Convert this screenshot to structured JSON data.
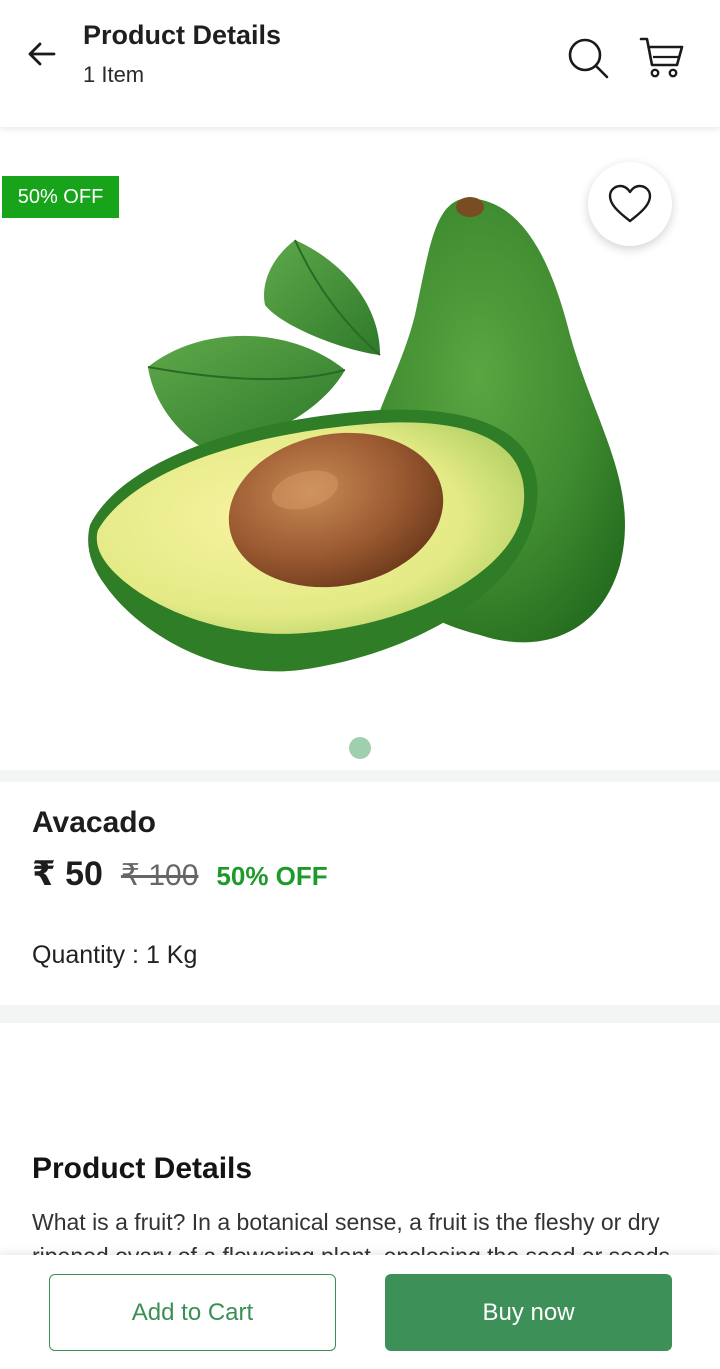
{
  "header": {
    "title": "Product Details",
    "subtitle": "1 Item",
    "icons": [
      "back-arrow-icon",
      "search-icon",
      "cart-icon"
    ]
  },
  "gallery": {
    "discount_tag": "50% OFF",
    "wishlist_icon": "heart-icon",
    "image": "avocado",
    "page_count": 1,
    "active_page": 1
  },
  "product": {
    "name": "Avacado",
    "price": "₹ 50",
    "mrp": "₹ 100",
    "discount": "50% OFF",
    "quantity": "Quantity : 1 Kg"
  },
  "details": {
    "title": "Product Details",
    "text": "What is a fruit? In a botanical sense, a fruit is the fleshy or dry ripened ovary of a flowering plant, enclosing the seed or seeds."
  },
  "actions": {
    "add_to_cart": "Add to Cart",
    "buy_now": "Buy now"
  },
  "colors": {
    "brand_green": "#3d9057",
    "discount_green": "#17a31a"
  }
}
